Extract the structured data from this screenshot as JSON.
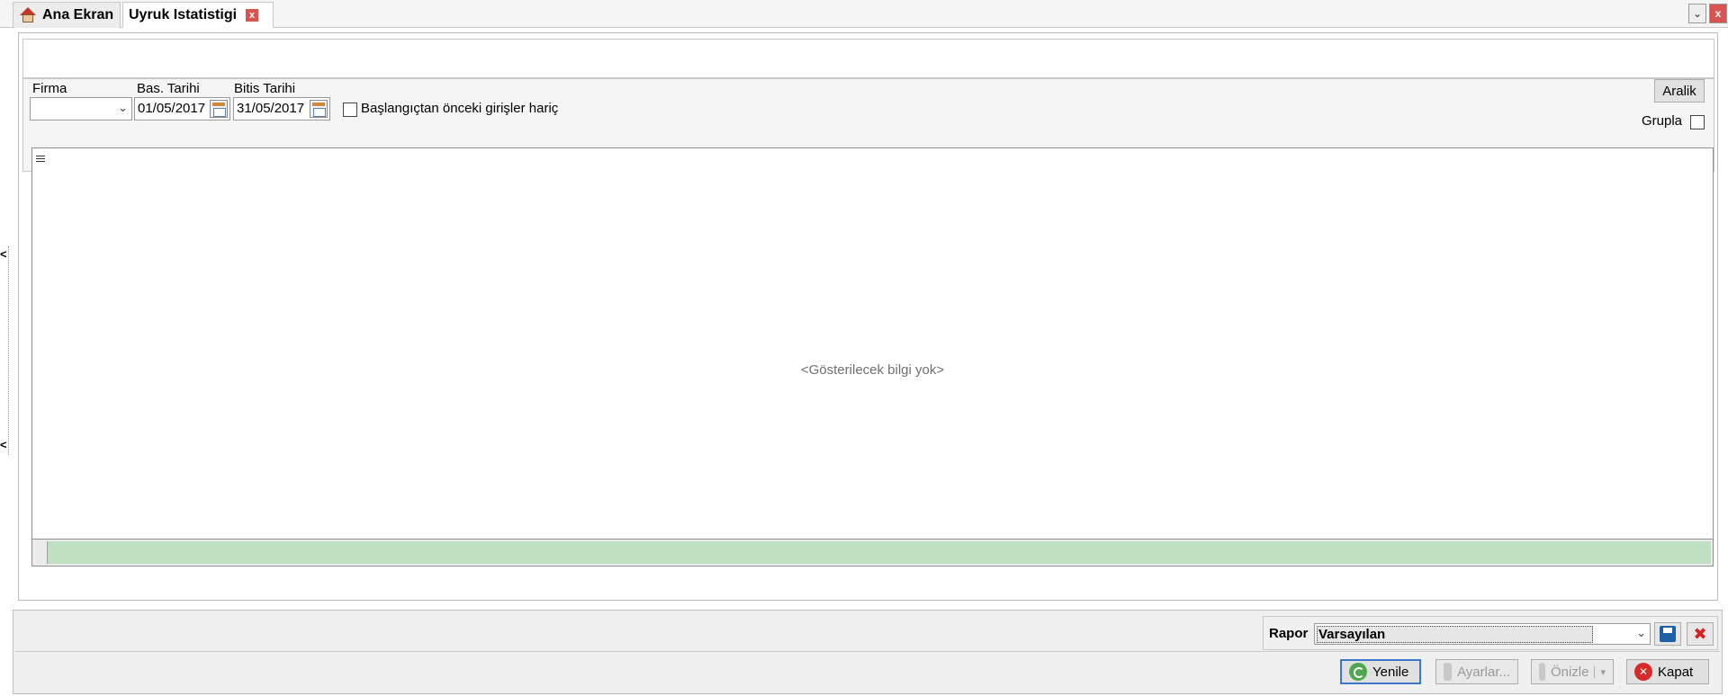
{
  "tabs": {
    "home_label": "Ana Ekran",
    "active_label": "Uyruk Istatistigi",
    "home_icon": "home-icon",
    "close_icon": "close-icon"
  },
  "window_buttons": {
    "dropdown_glyph": "⌄",
    "close_glyph": "x"
  },
  "filters": {
    "firma_label": "Firma",
    "firma_value": "",
    "bas_tarihi_label": "Bas. Tarihi",
    "bas_tarihi_value": "01/05/2017",
    "bitis_tarihi_label": "Bitis Tarihi",
    "bitis_tarihi_value": "31/05/2017",
    "exclude_checkbox_label": "Başlangıçtan önceki girişler hariç",
    "exclude_checked": false,
    "aralik_button": "Aralik",
    "grupla_label": "Grupla",
    "grupla_checked": false
  },
  "grid": {
    "empty_message": "<Gösterilecek bilgi yok>"
  },
  "report": {
    "label": "Rapor",
    "selected": "Varsayılan"
  },
  "actions": {
    "yenile": "Yenile",
    "ayarlar": "Ayarlar...",
    "onizle": "Önizle",
    "kapat": "Kapat"
  },
  "colors": {
    "accent_blue": "#3b7ac9",
    "footer_green": "#bfe0c2",
    "close_red": "#d9534f"
  }
}
